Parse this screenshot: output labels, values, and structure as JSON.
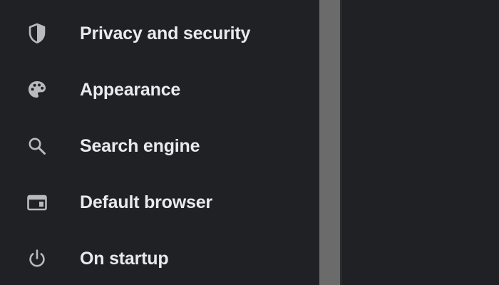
{
  "sidebar": {
    "items": [
      {
        "label": "Privacy and security",
        "icon": "shield-icon"
      },
      {
        "label": "Appearance",
        "icon": "palette-icon"
      },
      {
        "label": "Search engine",
        "icon": "search-icon"
      },
      {
        "label": "Default browser",
        "icon": "browser-window-icon"
      },
      {
        "label": "On startup",
        "icon": "power-icon"
      }
    ]
  },
  "colors": {
    "background": "#202124",
    "text": "#e8eaed",
    "icon": "#b8babd",
    "scrollbar": "#6b6b6b"
  }
}
